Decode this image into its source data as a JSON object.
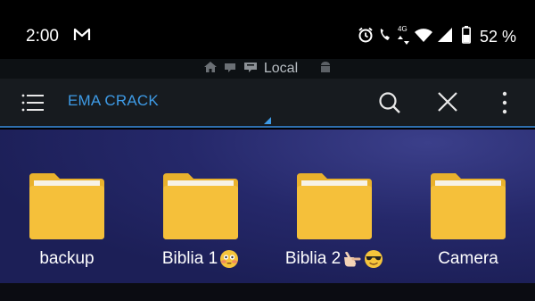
{
  "status_bar": {
    "time": "2:00",
    "notification_icons": [
      "gmail-icon"
    ],
    "system_icons": [
      "alarm-icon",
      "wifi-calling-icon",
      "4g-icon",
      "wifi-icon",
      "signal-icon",
      "battery-icon"
    ],
    "network_label": "4G",
    "battery_percent": "52 %"
  },
  "breadcrumbs": {
    "icons": [
      "home-icon",
      "storage-icon",
      "sd-icon",
      "android-icon"
    ],
    "current": "Local"
  },
  "toolbar": {
    "title": "EMA CRACK",
    "accent_color": "#3e9be6",
    "actions": [
      "search-icon",
      "close-icon",
      "more-vert-icon"
    ]
  },
  "files": [
    {
      "name": "backup",
      "emoji": []
    },
    {
      "name": "Biblia 1",
      "emoji": [
        "flushed-face"
      ]
    },
    {
      "name": "Biblia 2",
      "emoji": [
        "pointing-hand",
        "sunglasses-face"
      ]
    },
    {
      "name": "Camera",
      "emoji": []
    }
  ],
  "colors": {
    "folder": "#f5c03a",
    "folder_tab": "#e9b12c",
    "background": "#1f2260"
  }
}
